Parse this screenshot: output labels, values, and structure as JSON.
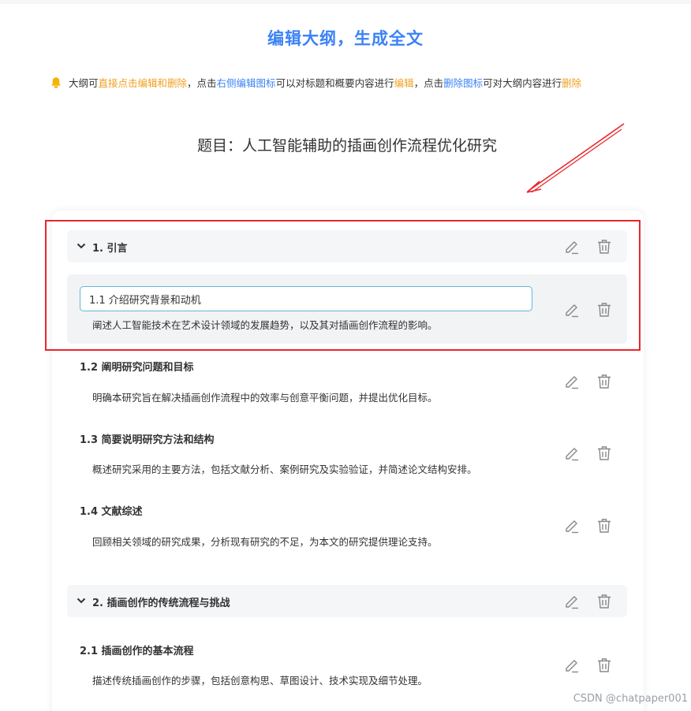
{
  "page": {
    "title": "编辑大纲，生成全文",
    "notice": {
      "p1": "大纲可",
      "p2": "直接点击编辑和删除",
      "p3": "，点击",
      "p4": "右侧编辑图标",
      "p5": "可以对标题和概要内容进行",
      "p6": "编辑",
      "p7": "，点击",
      "p8": "删除图标",
      "p9": "可对大纲内容进行",
      "p10": "删除"
    },
    "topic": "题目：人工智能辅助的插画创作流程优化研究"
  },
  "chapters": [
    {
      "title": "1. 引言"
    },
    {
      "title": "2. 插画创作的传统流程与挑战"
    }
  ],
  "sections": [
    {
      "title": "1.1 介绍研究背景和动机",
      "desc": "阐述人工智能技术在艺术设计领域的发展趋势，以及其对插画创作流程的影响。"
    },
    {
      "title": "1.2 阐明研究问题和目标",
      "desc": "明确本研究旨在解决插画创作流程中的效率与创意平衡问题，并提出优化目标。"
    },
    {
      "title": "1.3 简要说明研究方法和结构",
      "desc": "概述研究采用的主要方法，包括文献分析、案例研究及实验验证，并简述论文结构安排。"
    },
    {
      "title": "1.4 文献综述",
      "desc": "回顾相关领域的研究成果，分析现有研究的不足，为本文的研究提供理论支持。"
    },
    {
      "title": "2.1 插画创作的基本流程",
      "desc": "描述传统插画创作的步骤，包括创意构思、草图设计、技术实现及细节处理。"
    }
  ],
  "colors": {
    "accent_blue": "#3b82f6",
    "accent_orange": "#f0a020",
    "annotation_red": "#e8262c"
  },
  "icons": {
    "edit": "pencil-icon",
    "delete": "trash-icon",
    "collapse": "chevron-down-icon",
    "notice": "bell-icon"
  },
  "watermark": "CSDN @chatpaper001"
}
